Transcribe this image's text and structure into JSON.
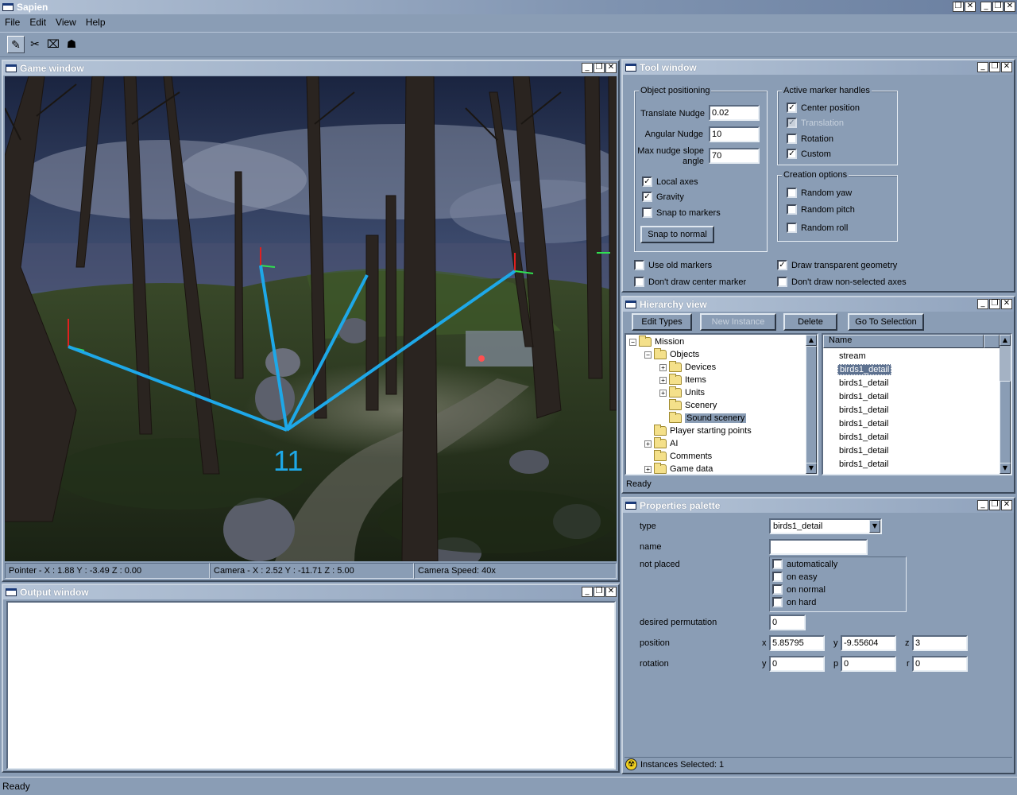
{
  "app": {
    "title": "Sapien",
    "status": "Ready"
  },
  "menu": [
    "File",
    "Edit",
    "View",
    "Help"
  ],
  "caption_buttons": {
    "minimize": "_",
    "restore": "❐",
    "close": "✕"
  },
  "toolbar": [
    {
      "icon": "pencil-icon",
      "glyph": "✎"
    },
    {
      "icon": "scissors-icon",
      "glyph": "✂"
    },
    {
      "icon": "camera-icon",
      "glyph": "⌧"
    },
    {
      "icon": "player-icon",
      "glyph": "☗"
    }
  ],
  "game_window": {
    "title": "Game window",
    "overlay_label": "11",
    "status": {
      "pointer": "Pointer - X : 1.88  Y : -3.49  Z : 0.00",
      "camera": "Camera - X : 2.52  Y : -11.71  Z : 5.00",
      "speed": "Camera Speed: 40x"
    }
  },
  "output_window": {
    "title": "Output window"
  },
  "tool_window": {
    "title": "Tool window",
    "object_positioning": {
      "label": "Object positioning",
      "translate_nudge_label": "Translate Nudge",
      "translate_nudge": "0.02",
      "angular_nudge_label": "Angular Nudge",
      "angular_nudge": "10",
      "max_slope_label_1": "Max nudge slope",
      "max_slope_label_2": "angle",
      "max_slope": "70",
      "local_axes": "Local axes",
      "gravity": "Gravity",
      "snap_markers": "Snap to markers",
      "snap_normal": "Snap to normal"
    },
    "marker_handles": {
      "label": "Active marker handles",
      "center": "Center position",
      "translation": "Translation",
      "rotation": "Rotation",
      "custom": "Custom"
    },
    "creation_options": {
      "label": "Creation options",
      "yaw": "Random yaw",
      "pitch": "Random pitch",
      "roll": "Random roll"
    },
    "use_old_markers": "Use old markers",
    "dont_draw_center": "Don't draw center marker",
    "draw_transparent": "Draw transparent geometry",
    "dont_draw_axes": "Don't draw non-selected axes"
  },
  "hierarchy": {
    "title": "Hierarchy view",
    "buttons": {
      "edit_types": "Edit Types",
      "new_instance": "New Instance",
      "delete": "Delete",
      "go_to": "Go To Selection"
    },
    "tree": {
      "mission": "Mission",
      "objects": "Objects",
      "devices": "Devices",
      "items": "Items",
      "units": "Units",
      "scenery": "Scenery",
      "sound_scenery": "Sound scenery",
      "player_start": "Player starting points",
      "ai": "AI",
      "comments": "Comments",
      "game_data": "Game data"
    },
    "list_header": "Name",
    "list_items": [
      "stream",
      "birds1_detail",
      "birds1_detail",
      "birds1_detail",
      "birds1_detail",
      "birds1_detail",
      "birds1_detail",
      "birds1_detail",
      "birds1_detail"
    ],
    "status": "Ready"
  },
  "properties": {
    "title": "Properties palette",
    "type_label": "type",
    "type_value": "birds1_detail",
    "name_label": "name",
    "not_placed_label": "not placed",
    "not_placed": {
      "auto": "automatically",
      "easy": "on easy",
      "normal": "on normal",
      "hard": "on hard"
    },
    "perm_label": "desired permutation",
    "perm_value": "0",
    "position_label": "position",
    "pos_x": "5.85795",
    "pos_y": "-9.55604",
    "pos_z": "3",
    "rotation_label": "rotation",
    "rot_y": "0",
    "rot_p": "0",
    "rot_r": "0",
    "axis_x": "x",
    "axis_y": "y",
    "axis_z": "z",
    "axis_p": "p",
    "axis_r": "r",
    "instances_selected": "Instances Selected: 1"
  },
  "colors": {
    "chrome": "#8a9db5",
    "marker_lines": "#1ea8e8"
  }
}
